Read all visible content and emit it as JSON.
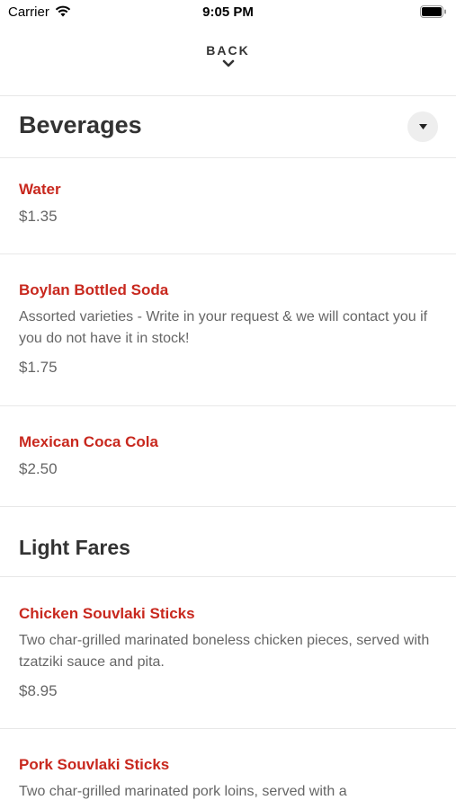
{
  "status_bar": {
    "carrier": "Carrier",
    "time": "9:05 PM"
  },
  "nav": {
    "back_label": "BACK"
  },
  "sections": [
    {
      "title": "Beverages",
      "items": [
        {
          "name": "Water",
          "price": "$1.35"
        },
        {
          "name": "Boylan Bottled Soda",
          "description": "Assorted varieties - Write in your request & we will contact you if you do not have it in stock!",
          "price": "$1.75"
        },
        {
          "name": "Mexican Coca Cola",
          "price": "$2.50"
        }
      ]
    },
    {
      "title": "Light Fares",
      "items": [
        {
          "name": "Chicken Souvlaki Sticks",
          "description": "Two char-grilled marinated boneless chicken pieces, served with tzatziki sauce and pita.",
          "price": "$8.95"
        },
        {
          "name": "Pork Souvlaki Sticks",
          "description": "Two char-grilled marinated pork loins, served with a"
        }
      ]
    }
  ],
  "colors": {
    "item_name": "#c8281e",
    "divider": "#e8e8e8"
  }
}
